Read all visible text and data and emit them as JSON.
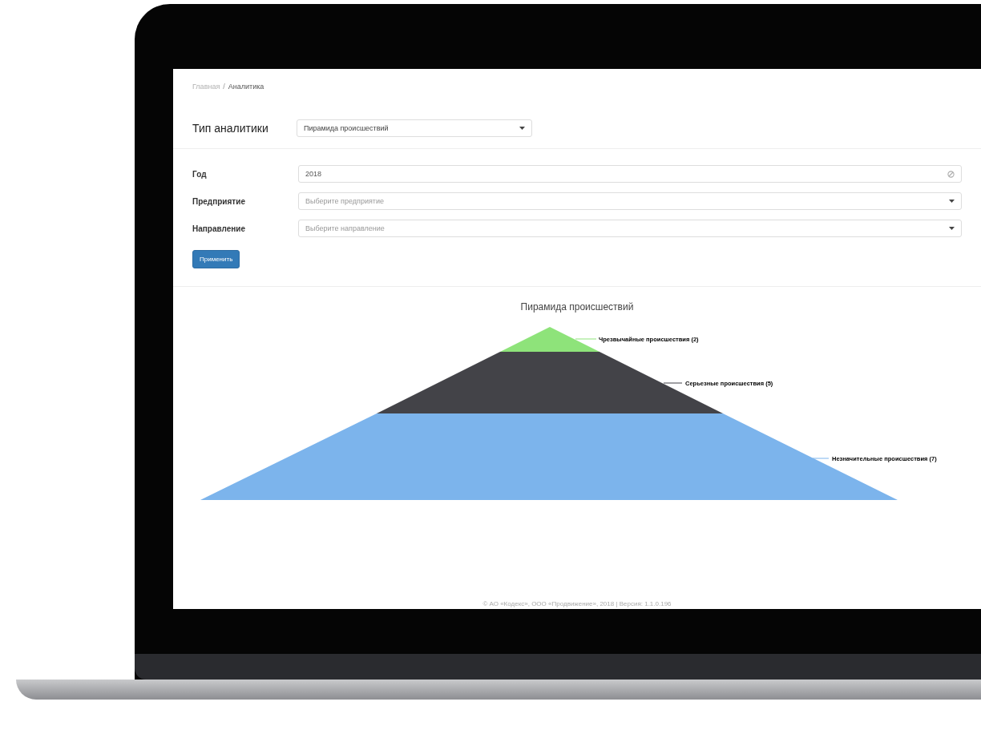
{
  "breadcrumb": [
    {
      "label": "Главная",
      "selected": false
    },
    {
      "label": "Аналитика",
      "selected": true
    }
  ],
  "breadcrumb_separator": "/",
  "analytics_type": {
    "label": "Тип аналитики",
    "value": "Пирамида происшествий"
  },
  "filters": [
    {
      "kind": "clearable",
      "label": "Год",
      "value": "2018"
    },
    {
      "kind": "select",
      "label": "Предприятие",
      "placeholder": "Выберите предприятие"
    },
    {
      "kind": "select",
      "label": "Направление",
      "placeholder": "Выберите направление"
    }
  ],
  "apply_button": "Применить",
  "chart": {
    "title": "Пирамида происшествий",
    "segments": [
      {
        "label": "Чрезвычайные происшествия (2)",
        "color": "#8ee37a"
      },
      {
        "label": "Серьезные происшествия (5)",
        "color": "#434348"
      },
      {
        "label": "Незначительные происшествия (7)",
        "color": "#7cb4ec"
      }
    ]
  },
  "footer": "© АО «Кодекс», ООО «Продвижение», 2018 | Версия: 1.1.0.196"
}
